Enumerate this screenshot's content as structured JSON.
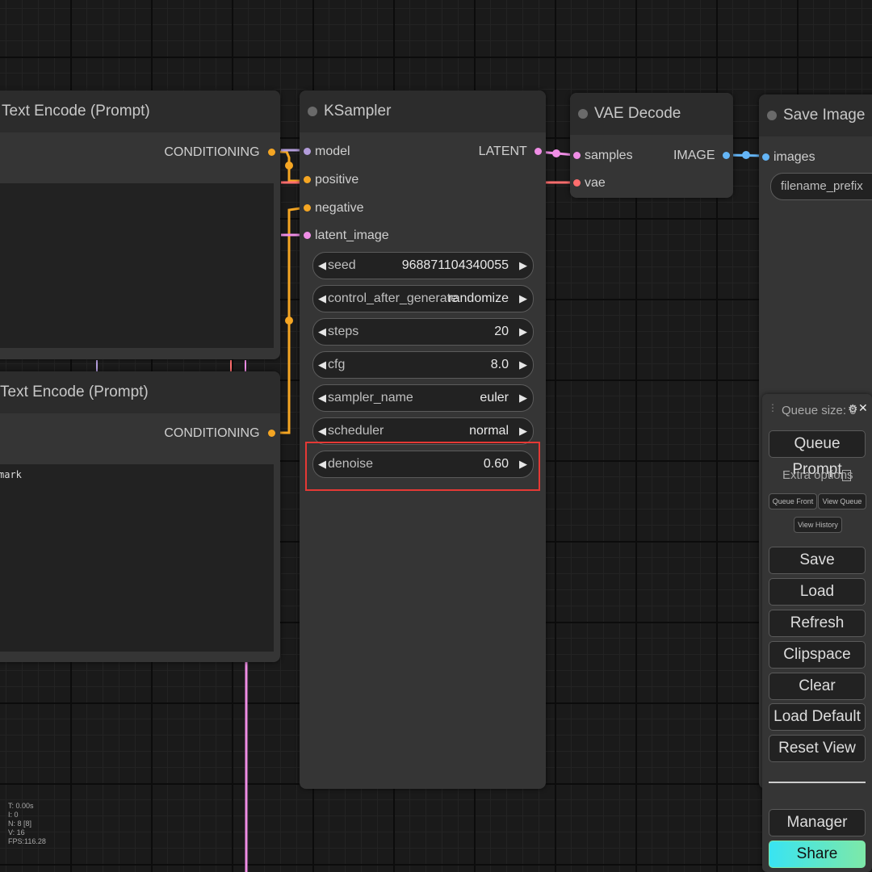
{
  "nodes": {
    "text_encode_top": {
      "title": "Text Encode (Prompt)",
      "output": "CONDITIONING"
    },
    "text_encode_bottom": {
      "title": "Text Encode (Prompt)",
      "output": "CONDITIONING",
      "text_fragment": "mark"
    },
    "ksampler": {
      "title": "KSampler",
      "inputs": [
        "model",
        "positive",
        "negative",
        "latent_image"
      ],
      "output": "LATENT",
      "widgets": [
        {
          "name": "seed",
          "value": "968871104340055"
        },
        {
          "name": "control_after_generate",
          "value": "randomize"
        },
        {
          "name": "steps",
          "value": "20"
        },
        {
          "name": "cfg",
          "value": "8.0"
        },
        {
          "name": "sampler_name",
          "value": "euler"
        },
        {
          "name": "scheduler",
          "value": "normal"
        },
        {
          "name": "denoise",
          "value": "0.60"
        }
      ]
    },
    "vae_decode": {
      "title": "VAE Decode",
      "inputs": [
        "samples",
        "vae"
      ],
      "output": "IMAGE"
    },
    "save_image": {
      "title": "Save Image",
      "input": "images",
      "widget": "filename_prefix"
    }
  },
  "queue_panel": {
    "queue_size": "Queue size: 0",
    "queue_prompt": "Queue Prompt",
    "extra_options": "Extra options",
    "queue_front": "Queue Front",
    "view_queue": "View Queue",
    "view_history": "View History",
    "buttons": [
      "Save",
      "Load",
      "Refresh",
      "Clipspace",
      "Clear",
      "Load Default",
      "Reset View"
    ],
    "manager": "Manager",
    "share": "Share"
  },
  "stats": [
    "T: 0.00s",
    "I: 0",
    "N: 8 [8]",
    "V: 16",
    "FPS:116.28"
  ],
  "colors": {
    "conditioning": "#f5a623",
    "latent": "#f08ee6",
    "image": "#64b5f6",
    "vae": "#ff6e6e",
    "model": "#b39ddb",
    "highlight": "#e53935"
  }
}
